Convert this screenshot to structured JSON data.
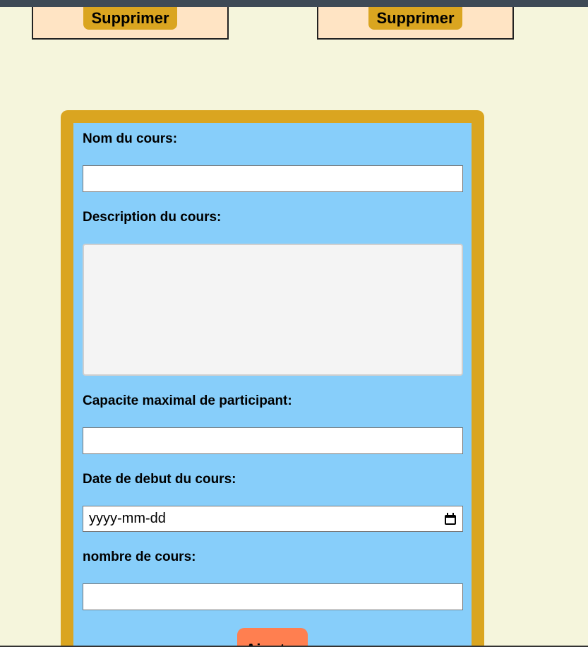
{
  "cards": [
    {
      "delete_label": "Supprimer"
    },
    {
      "delete_label": "Supprimer"
    }
  ],
  "form": {
    "name_label": "Nom du cours:",
    "name_value": "",
    "description_label": "Description du cours:",
    "description_value": "",
    "capacity_label": "Capacite maximal de participant:",
    "capacity_value": "",
    "start_date_label": "Date de debut du cours:",
    "start_date_placeholder": "yyyy-mm-dd",
    "count_label": "nombre de cours:",
    "count_value": "",
    "submit_label": "Ajouter"
  },
  "colors": {
    "page_background": "#f5f5dc",
    "card_background": "#ffe4c4",
    "button_gold": "#daa520",
    "form_background": "#87cefa",
    "submit_button": "#ff7f50"
  }
}
